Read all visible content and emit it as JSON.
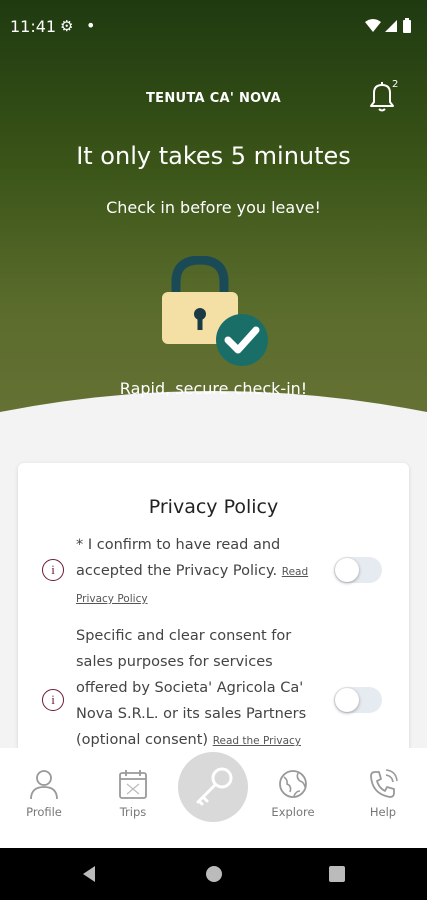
{
  "status_bar": {
    "time": "11:41",
    "icons": [
      "gear-icon",
      "dot-icon",
      "wifi-icon",
      "signal-icon",
      "battery-icon"
    ]
  },
  "header": {
    "brand": "TENUTA CA' NOVA",
    "notification_count": "2"
  },
  "hero": {
    "title": "It only takes 5 minutes",
    "subtitle": "Check in before you leave!",
    "caption": "Rapid, secure check-in!"
  },
  "privacy": {
    "title": "Privacy Policy",
    "items": [
      {
        "text": "*   I confirm to have read and accepted the Privacy Policy.",
        "link": "Read Privacy Policy",
        "checked": false
      },
      {
        "text": "Specific and clear consent for sales purposes for services offered by Societa' Agricola Ca' Nova S.R.L. or its sales Partners (optional consent)",
        "link": "Read the Privacy",
        "checked": false
      }
    ]
  },
  "nav": {
    "items": [
      {
        "label": "Profile",
        "icon": "person-icon"
      },
      {
        "label": "Trips",
        "icon": "calendar-icon"
      },
      {
        "label": "",
        "icon": "key-icon"
      },
      {
        "label": "Explore",
        "icon": "globe-icon"
      },
      {
        "label": "Help",
        "icon": "phone-icon"
      }
    ]
  },
  "colors": {
    "hero_dark": "#1f3a10",
    "hero_light": "#6a7438",
    "accent_teal": "#1a6e68",
    "info_icon": "#6b1b2c"
  }
}
